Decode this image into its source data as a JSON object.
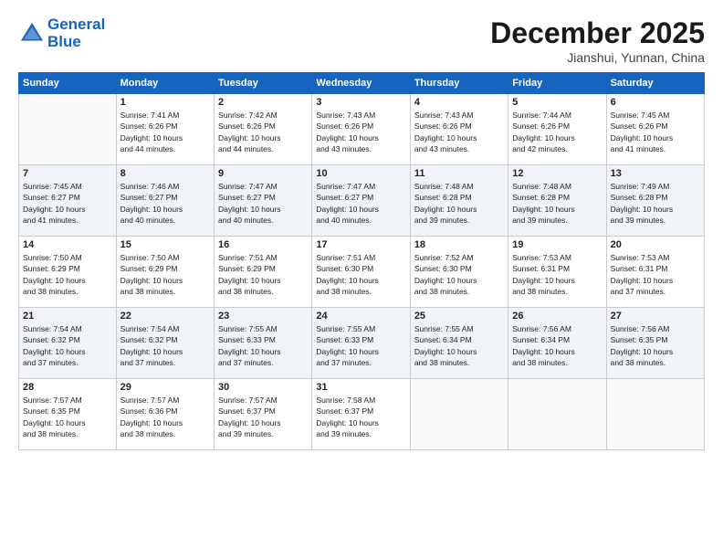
{
  "header": {
    "logo_line1": "General",
    "logo_line2": "Blue",
    "month": "December 2025",
    "location": "Jianshui, Yunnan, China"
  },
  "weekdays": [
    "Sunday",
    "Monday",
    "Tuesday",
    "Wednesday",
    "Thursday",
    "Friday",
    "Saturday"
  ],
  "weeks": [
    [
      {
        "day": "",
        "info": ""
      },
      {
        "day": "1",
        "info": "Sunrise: 7:41 AM\nSunset: 6:26 PM\nDaylight: 10 hours\nand 44 minutes."
      },
      {
        "day": "2",
        "info": "Sunrise: 7:42 AM\nSunset: 6:26 PM\nDaylight: 10 hours\nand 44 minutes."
      },
      {
        "day": "3",
        "info": "Sunrise: 7:43 AM\nSunset: 6:26 PM\nDaylight: 10 hours\nand 43 minutes."
      },
      {
        "day": "4",
        "info": "Sunrise: 7:43 AM\nSunset: 6:26 PM\nDaylight: 10 hours\nand 43 minutes."
      },
      {
        "day": "5",
        "info": "Sunrise: 7:44 AM\nSunset: 6:26 PM\nDaylight: 10 hours\nand 42 minutes."
      },
      {
        "day": "6",
        "info": "Sunrise: 7:45 AM\nSunset: 6:26 PM\nDaylight: 10 hours\nand 41 minutes."
      }
    ],
    [
      {
        "day": "7",
        "info": "Sunrise: 7:45 AM\nSunset: 6:27 PM\nDaylight: 10 hours\nand 41 minutes."
      },
      {
        "day": "8",
        "info": "Sunrise: 7:46 AM\nSunset: 6:27 PM\nDaylight: 10 hours\nand 40 minutes."
      },
      {
        "day": "9",
        "info": "Sunrise: 7:47 AM\nSunset: 6:27 PM\nDaylight: 10 hours\nand 40 minutes."
      },
      {
        "day": "10",
        "info": "Sunrise: 7:47 AM\nSunset: 6:27 PM\nDaylight: 10 hours\nand 40 minutes."
      },
      {
        "day": "11",
        "info": "Sunrise: 7:48 AM\nSunset: 6:28 PM\nDaylight: 10 hours\nand 39 minutes."
      },
      {
        "day": "12",
        "info": "Sunrise: 7:48 AM\nSunset: 6:28 PM\nDaylight: 10 hours\nand 39 minutes."
      },
      {
        "day": "13",
        "info": "Sunrise: 7:49 AM\nSunset: 6:28 PM\nDaylight: 10 hours\nand 39 minutes."
      }
    ],
    [
      {
        "day": "14",
        "info": "Sunrise: 7:50 AM\nSunset: 6:29 PM\nDaylight: 10 hours\nand 38 minutes."
      },
      {
        "day": "15",
        "info": "Sunrise: 7:50 AM\nSunset: 6:29 PM\nDaylight: 10 hours\nand 38 minutes."
      },
      {
        "day": "16",
        "info": "Sunrise: 7:51 AM\nSunset: 6:29 PM\nDaylight: 10 hours\nand 38 minutes."
      },
      {
        "day": "17",
        "info": "Sunrise: 7:51 AM\nSunset: 6:30 PM\nDaylight: 10 hours\nand 38 minutes."
      },
      {
        "day": "18",
        "info": "Sunrise: 7:52 AM\nSunset: 6:30 PM\nDaylight: 10 hours\nand 38 minutes."
      },
      {
        "day": "19",
        "info": "Sunrise: 7:53 AM\nSunset: 6:31 PM\nDaylight: 10 hours\nand 38 minutes."
      },
      {
        "day": "20",
        "info": "Sunrise: 7:53 AM\nSunset: 6:31 PM\nDaylight: 10 hours\nand 37 minutes."
      }
    ],
    [
      {
        "day": "21",
        "info": "Sunrise: 7:54 AM\nSunset: 6:32 PM\nDaylight: 10 hours\nand 37 minutes."
      },
      {
        "day": "22",
        "info": "Sunrise: 7:54 AM\nSunset: 6:32 PM\nDaylight: 10 hours\nand 37 minutes."
      },
      {
        "day": "23",
        "info": "Sunrise: 7:55 AM\nSunset: 6:33 PM\nDaylight: 10 hours\nand 37 minutes."
      },
      {
        "day": "24",
        "info": "Sunrise: 7:55 AM\nSunset: 6:33 PM\nDaylight: 10 hours\nand 37 minutes."
      },
      {
        "day": "25",
        "info": "Sunrise: 7:55 AM\nSunset: 6:34 PM\nDaylight: 10 hours\nand 38 minutes."
      },
      {
        "day": "26",
        "info": "Sunrise: 7:56 AM\nSunset: 6:34 PM\nDaylight: 10 hours\nand 38 minutes."
      },
      {
        "day": "27",
        "info": "Sunrise: 7:56 AM\nSunset: 6:35 PM\nDaylight: 10 hours\nand 38 minutes."
      }
    ],
    [
      {
        "day": "28",
        "info": "Sunrise: 7:57 AM\nSunset: 6:35 PM\nDaylight: 10 hours\nand 38 minutes."
      },
      {
        "day": "29",
        "info": "Sunrise: 7:57 AM\nSunset: 6:36 PM\nDaylight: 10 hours\nand 38 minutes."
      },
      {
        "day": "30",
        "info": "Sunrise: 7:57 AM\nSunset: 6:37 PM\nDaylight: 10 hours\nand 39 minutes."
      },
      {
        "day": "31",
        "info": "Sunrise: 7:58 AM\nSunset: 6:37 PM\nDaylight: 10 hours\nand 39 minutes."
      },
      {
        "day": "",
        "info": ""
      },
      {
        "day": "",
        "info": ""
      },
      {
        "day": "",
        "info": ""
      }
    ]
  ]
}
